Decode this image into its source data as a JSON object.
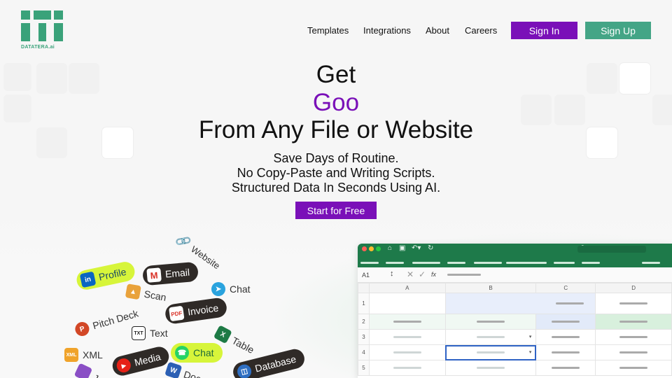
{
  "brand": {
    "name": "DATATERA.ai",
    "color": "#3aa27a"
  },
  "nav": {
    "links": [
      "Templates",
      "Integrations",
      "About",
      "Careers"
    ],
    "signin_label": "Sign In",
    "signup_label": "Sign Up"
  },
  "hero": {
    "line1": "Get",
    "line2": "Goo",
    "line3": "From Any File or Website",
    "sub1": "Save Days of Routine.",
    "sub2": "No Copy-Paste and Writing Scripts.",
    "sub3": "Structured Data In Seconds Using AI.",
    "cta_label": "Start for Free"
  },
  "sources": {
    "website": "Website",
    "profile": "Profile",
    "email": "Email",
    "chat_top": "Chat",
    "scan": "Scan",
    "invoice": "Invoice",
    "pitch_deck": "Pitch Deck",
    "text": "Text",
    "table": "Table",
    "xml": "XML",
    "media": "Media",
    "chat_green": "Chat",
    "database": "Database",
    "doc_partial": "Doc",
    "js_partial": "Js"
  },
  "sheet": {
    "cell_ref": "A1",
    "fx": "fx",
    "columns": [
      "A",
      "B",
      "C",
      "D"
    ],
    "rows": [
      "1",
      "2",
      "3",
      "4",
      "5"
    ]
  },
  "colors": {
    "purple": "#7a10b8",
    "green": "#44a586",
    "sheet_green": "#1e7a4a"
  }
}
